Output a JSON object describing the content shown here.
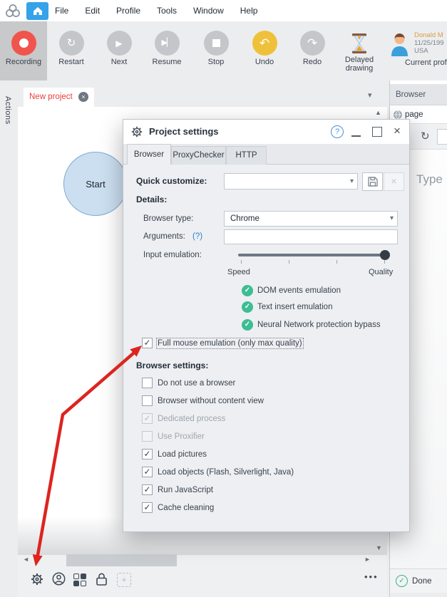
{
  "menu": {
    "items": [
      "File",
      "Edit",
      "Profile",
      "Tools",
      "Window",
      "Help"
    ]
  },
  "toolbar": {
    "buttons": [
      {
        "label": "Recording"
      },
      {
        "label": "Restart"
      },
      {
        "label": "Next"
      },
      {
        "label": "Resume"
      },
      {
        "label": "Stop"
      },
      {
        "label": "Undo"
      },
      {
        "label": "Redo"
      },
      {
        "label": "Delayed drawing"
      },
      {
        "label": "Current profile"
      }
    ],
    "profile": {
      "name": "Donald M",
      "birthdate": "11/25/199",
      "country": "USA"
    }
  },
  "sidebar": {
    "label": "Actions"
  },
  "tabbar": {
    "active_tab": "New project"
  },
  "canvas": {
    "start_node_label": "Start"
  },
  "browser_panel": {
    "title": "Browser",
    "page_item": "page",
    "content_text": "Type",
    "status": "Done"
  },
  "dialog": {
    "title": "Project settings",
    "tabs": [
      "Browser",
      "ProxyChecker",
      "HTTP"
    ],
    "quick_customize": {
      "label": "Quick customize:",
      "value": ""
    },
    "details_label": "Details:",
    "browser_type": {
      "label": "Browser type:",
      "value": "Chrome"
    },
    "arguments": {
      "label": "Arguments:",
      "help": "(?)",
      "value": ""
    },
    "input_emulation": {
      "label": "Input emulation:",
      "min_label": "Speed",
      "max_label": "Quality",
      "value": 1.0
    },
    "emulation_features": [
      "DOM events emulation",
      "Text insert emulation",
      "Neural Network protection bypass"
    ],
    "full_mouse": {
      "label": "Full mouse emulation (only max quality)",
      "checked": true
    },
    "browser_settings_label": "Browser settings:",
    "browser_settings": [
      {
        "label": "Do not use a browser",
        "checked": false,
        "disabled": false
      },
      {
        "label": "Browser without content view",
        "checked": false,
        "disabled": false
      },
      {
        "label": "Dedicated process",
        "checked": true,
        "disabled": true
      },
      {
        "label": "Use Proxifier",
        "checked": false,
        "disabled": true
      },
      {
        "label": "Load pictures",
        "checked": true,
        "disabled": false
      },
      {
        "label": "Load objects (Flash, Silverlight, Java)",
        "checked": true,
        "disabled": false
      },
      {
        "label": "Run JavaScript",
        "checked": true,
        "disabled": false
      },
      {
        "label": "Cache cleaning",
        "checked": true,
        "disabled": false
      }
    ]
  },
  "icons": {
    "caret_down": "▾",
    "scroll_up": "▲",
    "scroll_down": "▼",
    "scroll_left": "◄",
    "scroll_right": "►",
    "close": "×",
    "check": "✓",
    "help": "?",
    "refresh": "↻",
    "restart": "↻",
    "play": "▶",
    "undo": "↶",
    "redo": "↷",
    "plus": "+",
    "ellipsis": "•••"
  },
  "colors": {
    "accent_blue": "#35a2e9",
    "recording_red": "#f1544d",
    "undo_yellow": "#efc13b",
    "tab_red": "#e8403d",
    "feature_green": "#3cbd92",
    "arrow_red": "#dd241f",
    "done_green": "#35b57f"
  }
}
